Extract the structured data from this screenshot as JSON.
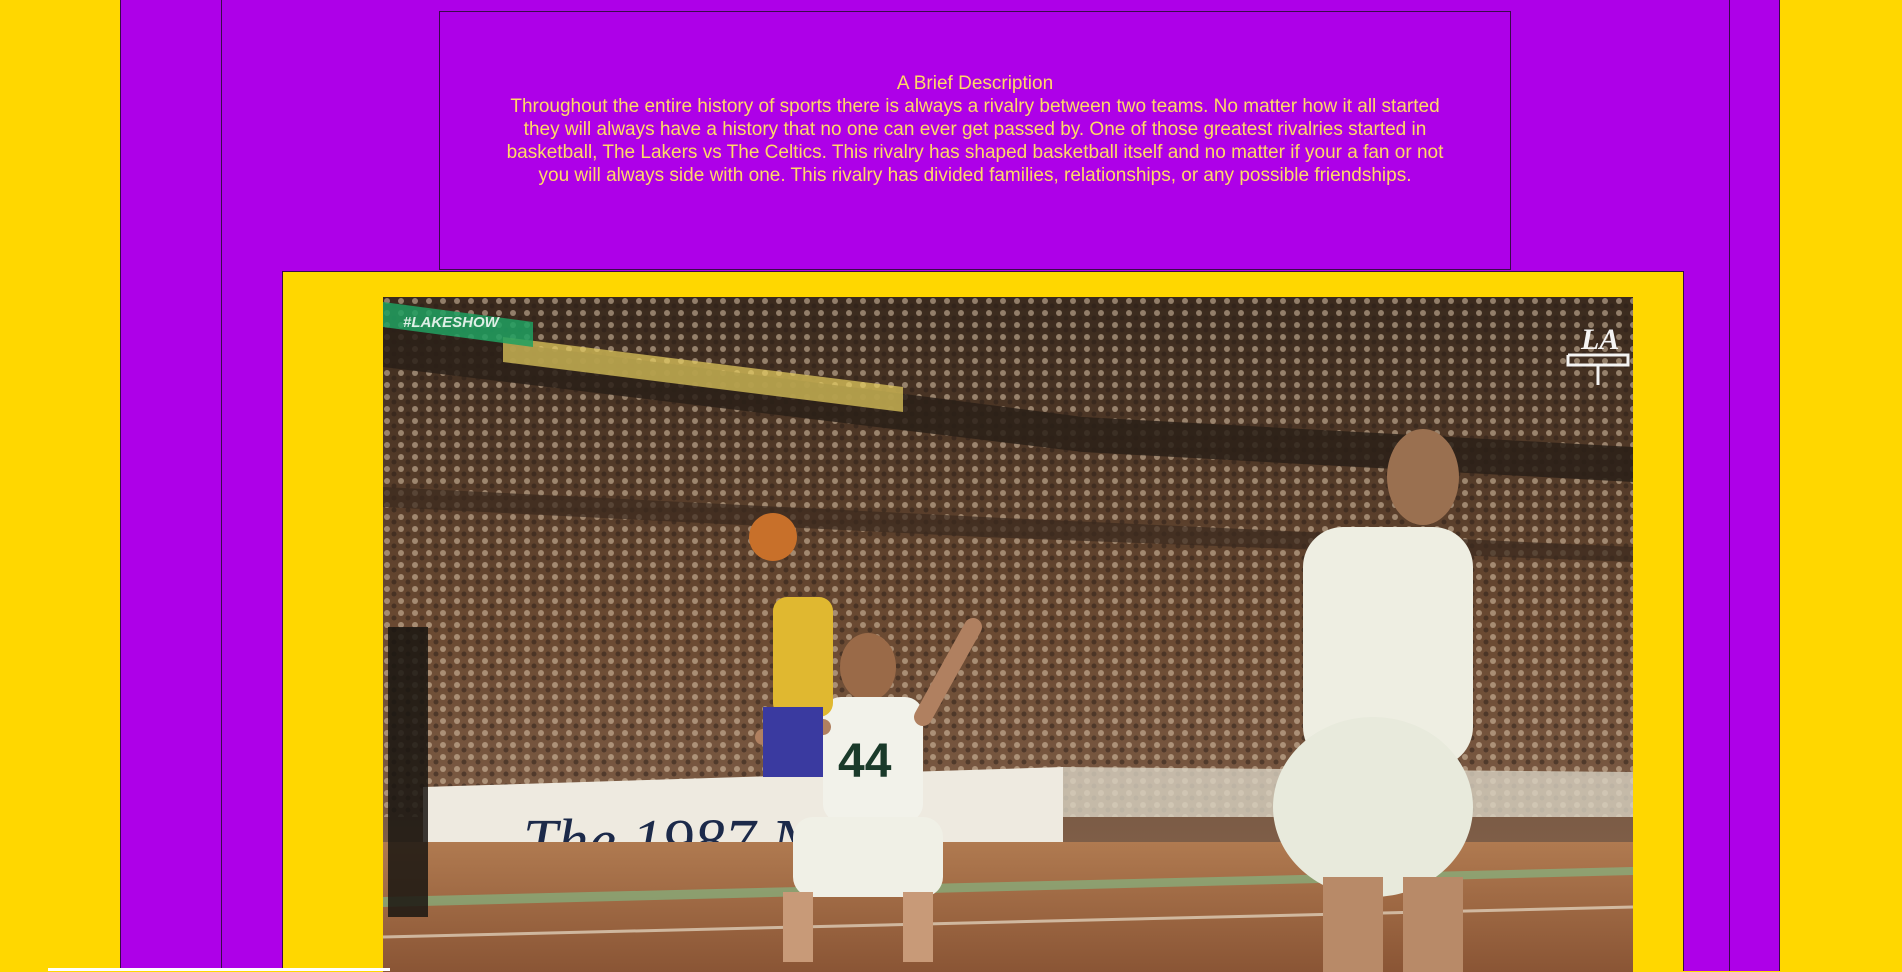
{
  "description": {
    "title": "A Brief Description",
    "body": "Throughout the entire history of sports there is always a rivalry between two teams. No matter how it all started they will always have a history that no one can ever get passed by. One of those greatest rivalries started in basketball, The Lakers vs The Celtics. This rivalry has shaped basketball itself and no matter if your a fan or not you will always side with one. This rivalry has divided families, relationships, or any possible friendships."
  },
  "media": {
    "overlay_tag": "#LAKESHOW",
    "banner_text": "The 1987 N",
    "jersey_number": "44",
    "logo_text": "LA"
  },
  "colors": {
    "page_background": "#FFD700",
    "panel_purple": "#AE00E8",
    "text_gold": "#FFD966"
  }
}
